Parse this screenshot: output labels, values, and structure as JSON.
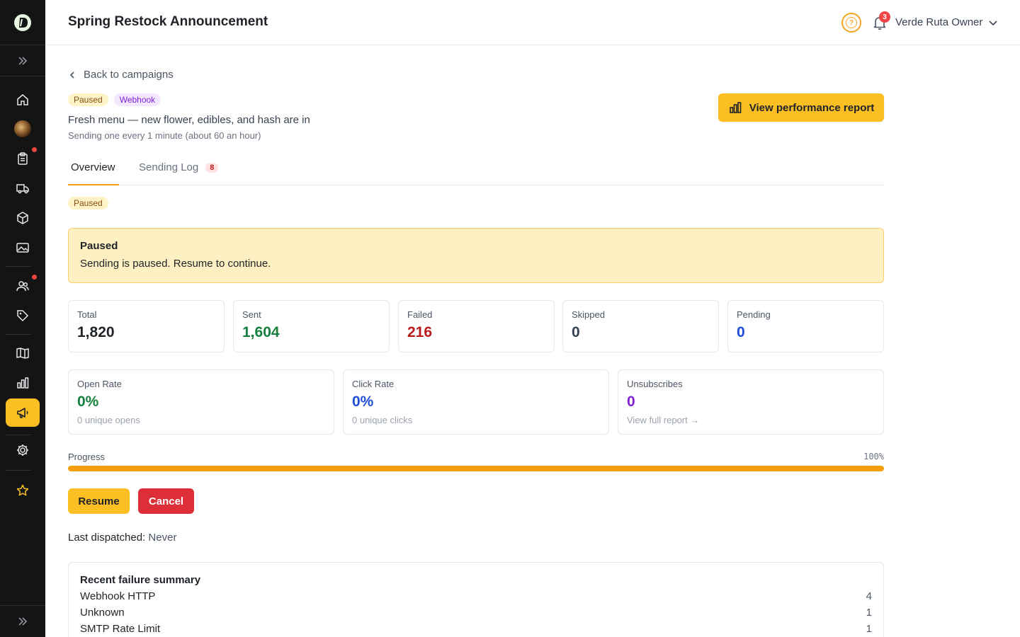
{
  "header": {
    "title": "Spring Restock Announcement",
    "notification_count": "3",
    "user_name": "Verde Ruta Owner"
  },
  "campaign": {
    "back_label": "Back to campaigns",
    "status_tag": "Paused",
    "channel_tag": "Webhook",
    "subject": "Fresh menu — new flower, edibles, and hash are in",
    "rate": "Sending one every 1 minute (about 60 an hour)",
    "perf_button": "View performance report"
  },
  "tabs": [
    {
      "label": "Overview",
      "active": true
    },
    {
      "label": "Sending Log",
      "count": "8"
    }
  ],
  "status_tag": "Paused",
  "alert": {
    "title": "Paused",
    "text": "Sending is paused. Resume to continue."
  },
  "stats": [
    {
      "label": "Total",
      "value": "1,820",
      "color": "#1f2328"
    },
    {
      "label": "Sent",
      "value": "1,604",
      "color": "#15803d"
    },
    {
      "label": "Failed",
      "value": "216",
      "color": "#b91c1c"
    },
    {
      "label": "Skipped",
      "value": "0",
      "color": "#374151"
    },
    {
      "label": "Pending",
      "value": "0",
      "color": "#1d4ed8"
    }
  ],
  "metrics": [
    {
      "label": "Open Rate",
      "value": "0%",
      "sub": "0 unique opens",
      "color": "#15803d"
    },
    {
      "label": "Click Rate",
      "value": "0%",
      "sub": "0 unique clicks",
      "color": "#1d4ed8"
    },
    {
      "label": "Unsubscribes",
      "value": "0",
      "sub": "View full report →",
      "color": "#7e22ce"
    }
  ],
  "progress": {
    "label": "Progress",
    "percent_label": "100%",
    "value": 1.0
  },
  "actions": {
    "resume": "Resume",
    "cancel": "Cancel"
  },
  "last_dispatched": {
    "label": "Last dispatched:",
    "value": "Never"
  },
  "failure_summary": {
    "title": "Recent failure summary",
    "rows": [
      {
        "reason": "Webhook HTTP",
        "count": "4"
      },
      {
        "reason": "Unknown",
        "count": "1"
      },
      {
        "reason": "SMTP Rate Limit",
        "count": "1"
      }
    ]
  },
  "sidebar": {
    "items": [
      {
        "icon": "home-icon"
      },
      {
        "icon": "avatar-image"
      },
      {
        "icon": "clipboard-icon",
        "dot": true
      },
      {
        "icon": "truck-icon"
      },
      {
        "icon": "box-icon"
      },
      {
        "icon": "image-icon"
      },
      {
        "icon": "users-icon",
        "dot": true
      },
      {
        "icon": "tag-icon"
      },
      {
        "icon": "map-icon"
      },
      {
        "icon": "bar-chart-icon"
      },
      {
        "icon": "megaphone-icon",
        "active": true
      },
      {
        "icon": "gear-icon"
      },
      {
        "icon": "star-icon"
      }
    ],
    "accent": "#fbbf24",
    "dot_color": "#ef4444"
  }
}
